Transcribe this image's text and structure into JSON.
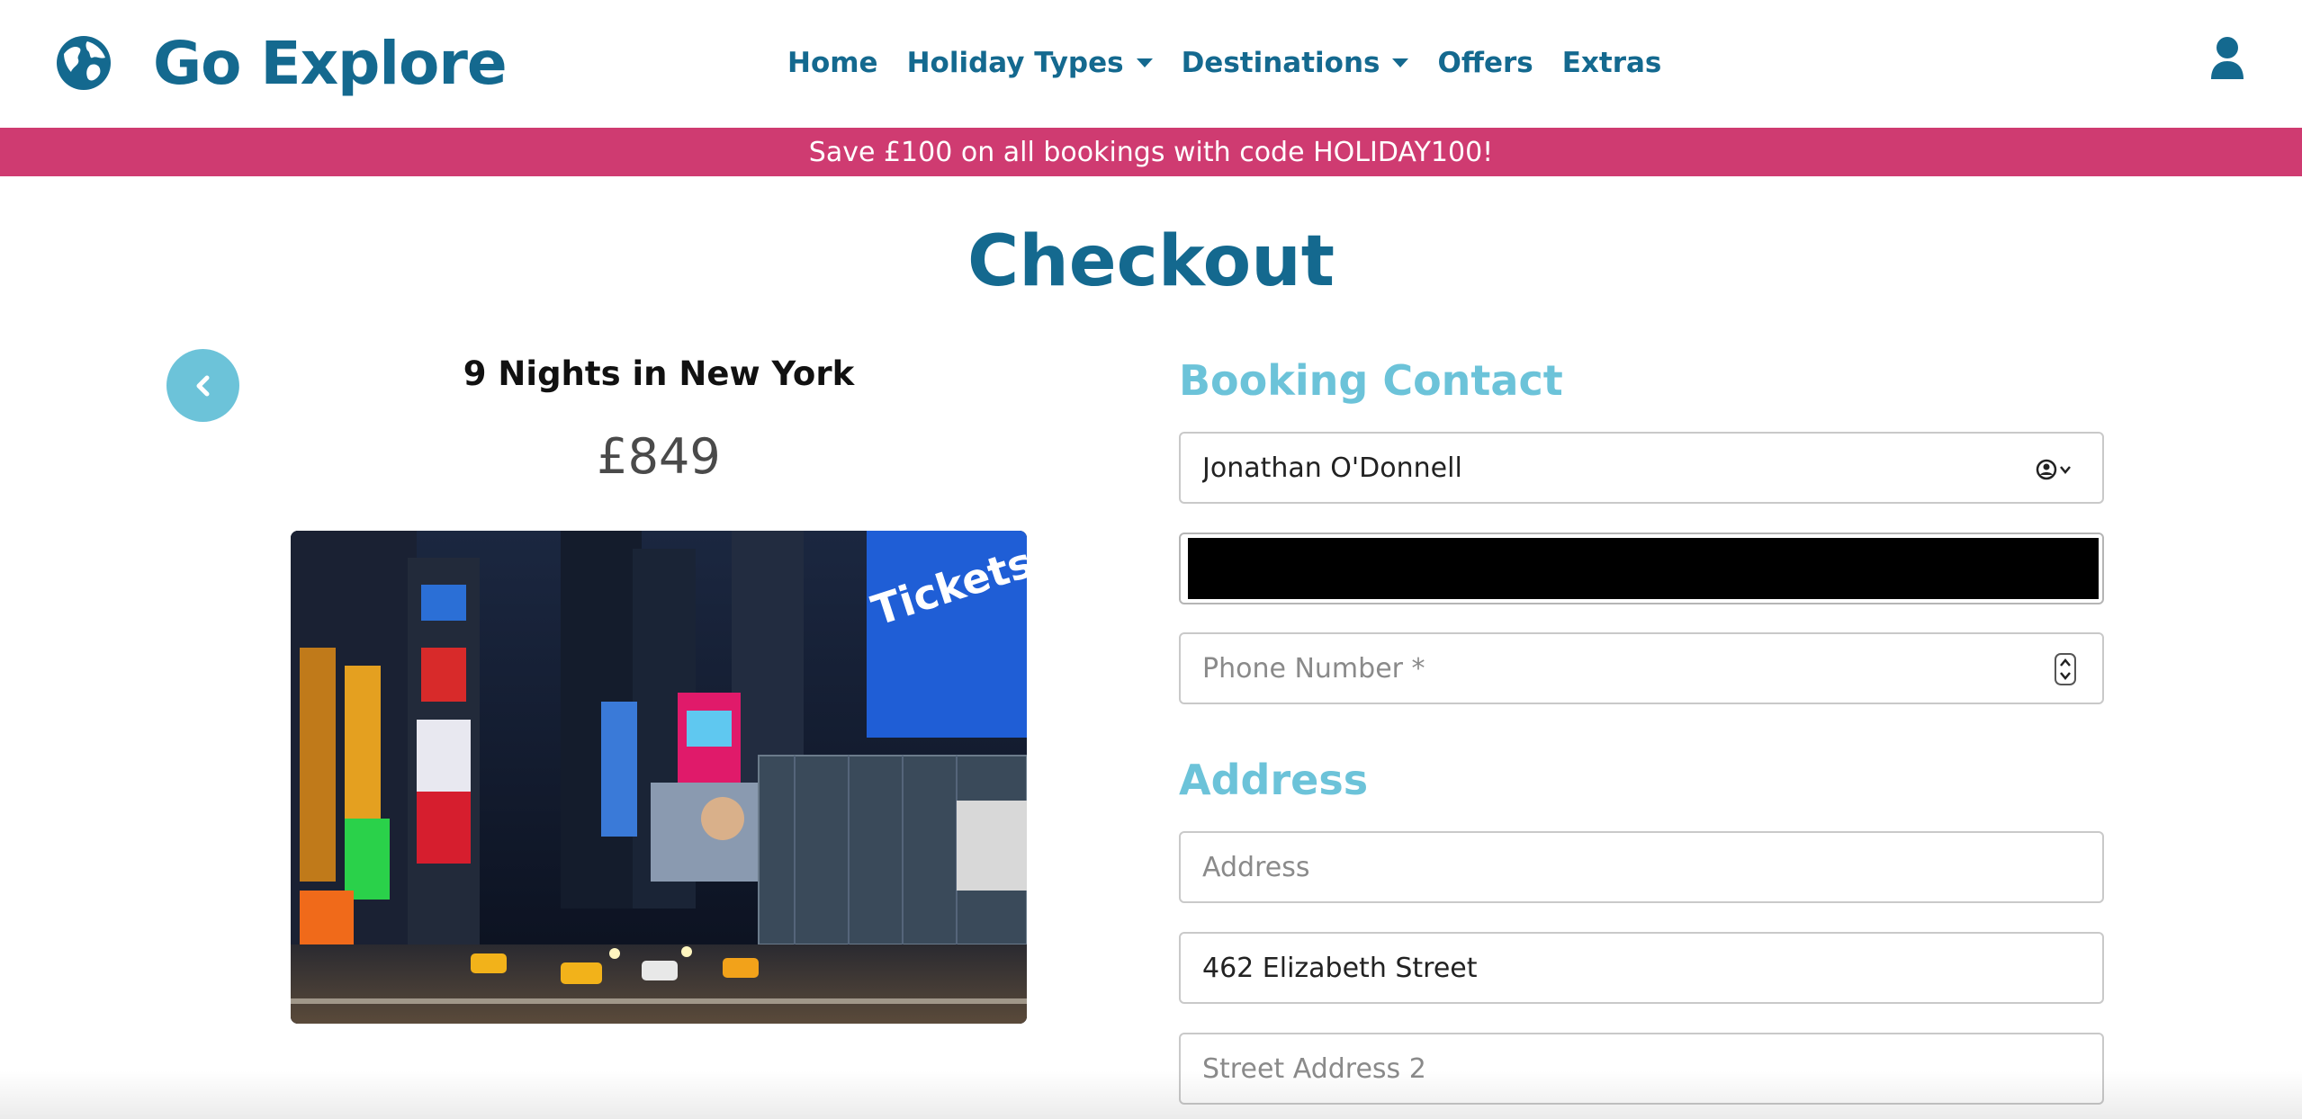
{
  "header": {
    "brand": "Go Explore",
    "nav": [
      {
        "label": "Home",
        "has_dropdown": false
      },
      {
        "label": "Holiday Types",
        "has_dropdown": true
      },
      {
        "label": "Destinations",
        "has_dropdown": true
      },
      {
        "label": "Offers",
        "has_dropdown": false
      },
      {
        "label": "Extras",
        "has_dropdown": false
      }
    ],
    "icons": {
      "logo": "globe-icon",
      "account": "user-icon"
    }
  },
  "promo_banner": {
    "text": "Save £100 on all bookings with code HOLIDAY100!"
  },
  "page": {
    "title": "Checkout"
  },
  "trip": {
    "title": "9 Nights in New York",
    "price": "£849",
    "back_icon": "chevron-left-icon",
    "image": "new-york-times-square-photo"
  },
  "booking_contact": {
    "heading": "Booking Contact",
    "name_value": "Jonathan O'Donnell",
    "email_value": "",
    "phone_placeholder": "Phone Number *"
  },
  "address": {
    "heading": "Address",
    "address_placeholder": "Address",
    "street1_value": "462 Elizabeth Street",
    "street2_placeholder": "Street Address 2"
  },
  "colors": {
    "primary": "#14698f",
    "accent": "#6cc3d9",
    "promo": "#cf3b71",
    "border": "#c9c9c9"
  }
}
